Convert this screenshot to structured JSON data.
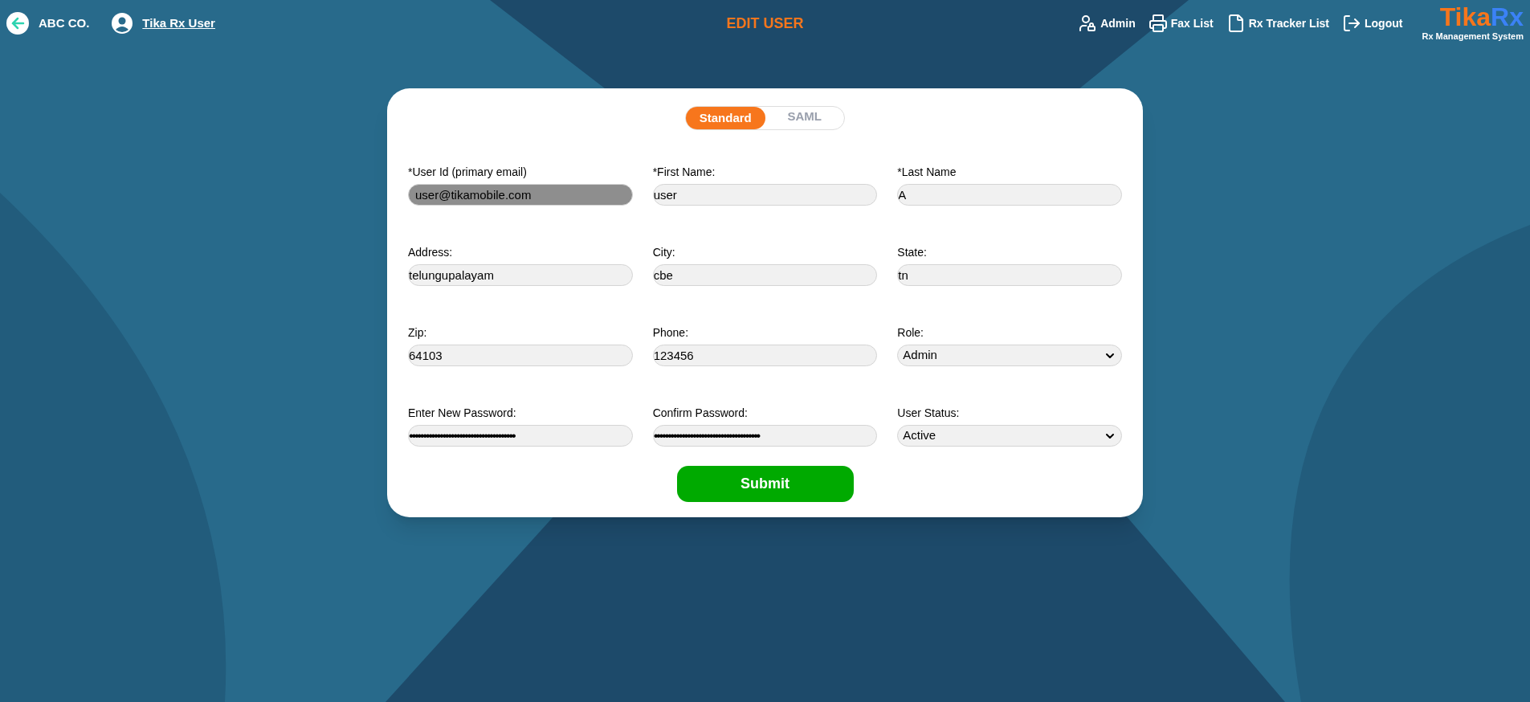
{
  "header": {
    "company": "ABC CO.",
    "user": "Tika Rx User",
    "title": "EDIT USER",
    "nav": [
      "Admin",
      "Fax List",
      "Rx Tracker List",
      "Logout"
    ],
    "logo": {
      "part_1": "Tika",
      "part_2": "Rx",
      "subtitle": "Rx Management System"
    }
  },
  "auth_tabs": [
    {
      "label": "Standard",
      "selected": true
    },
    {
      "label": "SAML",
      "selected": false
    }
  ],
  "fields": [
    {
      "label": "*User Id (primary email)",
      "value": "user@tikamobile.com",
      "kind": "text",
      "disabled": true
    },
    {
      "label": "*First Name:",
      "value": "user",
      "kind": "text",
      "disabled": false
    },
    {
      "label": "*Last Name",
      "value": "A",
      "kind": "text",
      "disabled": false
    },
    {
      "label": "Address:",
      "value": "telungupalayam",
      "kind": "text",
      "disabled": false
    },
    {
      "label": "City:",
      "value": "cbe",
      "kind": "text",
      "disabled": false
    },
    {
      "label": "State:",
      "value": "tn",
      "kind": "text",
      "disabled": false
    },
    {
      "label": "Zip:",
      "value": "64103",
      "kind": "text",
      "disabled": false
    },
    {
      "label": "Phone:",
      "value": "123456",
      "kind": "text",
      "disabled": false
    },
    {
      "label": "Role:",
      "value": "Admin",
      "kind": "select",
      "disabled": false
    },
    {
      "label": "Enter New Password:",
      "value": "••••••••••••••••••••••••••••••••••••••",
      "kind": "password",
      "disabled": false
    },
    {
      "label": "Confirm Password:",
      "value": "••••••••••••••••••••••••••••••••••••••",
      "kind": "password",
      "disabled": false
    },
    {
      "label": "User Status:",
      "value": "Active",
      "kind": "select",
      "disabled": false
    }
  ],
  "submit": "Submit"
}
